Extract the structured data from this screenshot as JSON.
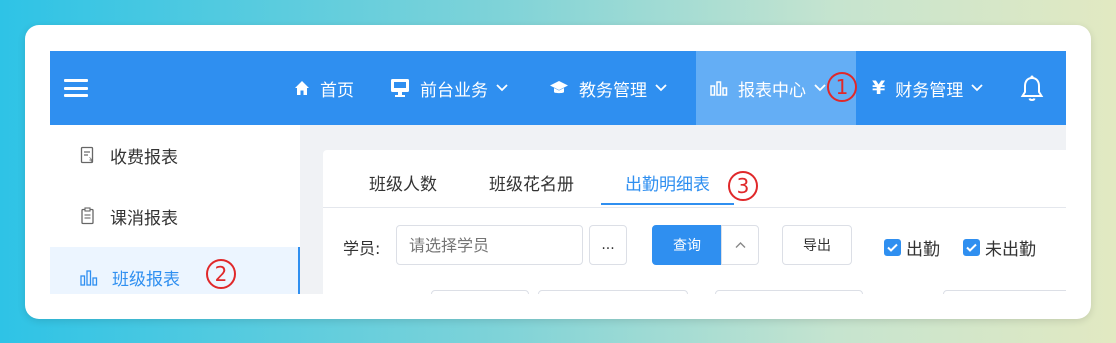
{
  "topnav": {
    "items": [
      {
        "label": "首页",
        "icon": "home-icon"
      },
      {
        "label": "前台业务",
        "icon": "monitor-icon"
      },
      {
        "label": "教务管理",
        "icon": "graduation-cap-icon"
      },
      {
        "label": "报表中心",
        "icon": "bar-chart-icon"
      },
      {
        "label": "财务管理",
        "icon": "yen-icon"
      }
    ],
    "active_index": 3,
    "accent": "#2f8ff0"
  },
  "sidebar": {
    "items": [
      {
        "label": "收费报表",
        "icon": "receipt-icon"
      },
      {
        "label": "课消报表",
        "icon": "clipboard-icon"
      },
      {
        "label": "班级报表",
        "icon": "bar-chart-icon"
      }
    ],
    "active_index": 2
  },
  "tabs": {
    "items": [
      "班级人数",
      "班级花名册",
      "出勤明细表"
    ],
    "active_index": 2
  },
  "filter": {
    "student_label": "学员:",
    "student_placeholder": "请选择学员",
    "more_label": "...",
    "query_label": "查询",
    "export_label": "导出",
    "checkboxes": [
      {
        "label": "出勤",
        "checked": true
      },
      {
        "label": "未出勤",
        "checked": true
      }
    ]
  },
  "annotations": [
    "1",
    "2",
    "3"
  ]
}
